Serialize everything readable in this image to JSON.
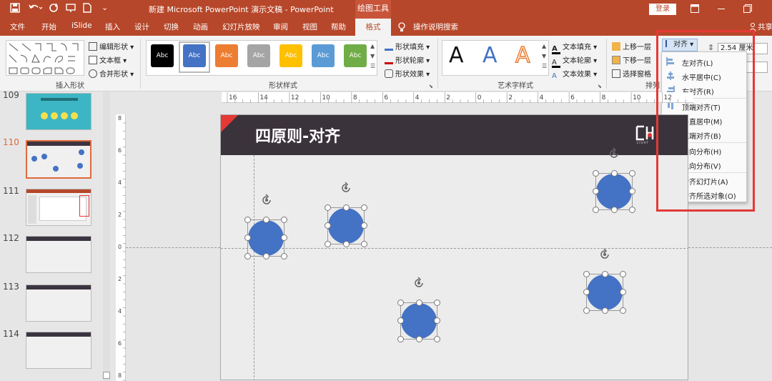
{
  "titlebar": {
    "title": "新建 Microsoft PowerPoint 演示文稿  -  PowerPoint",
    "context_tab": "绘图工具",
    "login": "登录"
  },
  "tabs": [
    "文件",
    "开始",
    "iSlide",
    "插入",
    "设计",
    "切换",
    "动画",
    "幻灯片放映",
    "审阅",
    "视图",
    "帮助",
    "格式"
  ],
  "tell_me": "操作说明搜索",
  "share": "共享",
  "ribbon": {
    "insert_shape": {
      "label": "插入形状",
      "edit_shape": "编辑形状",
      "text_box": "文本框",
      "merge_shapes": "合并形状"
    },
    "shape_styles": {
      "label": "形状样式",
      "swatch_text": "Abc",
      "fill": "形状填充",
      "outline": "形状轮廓",
      "effects": "形状效果",
      "swatch_colors": [
        "#000000",
        "#4472c4",
        "#ed7d31",
        "#a5a5a5",
        "#ffc000",
        "#5b9bd5",
        "#70ad47"
      ]
    },
    "wordart": {
      "label": "艺术字样式",
      "glyph": "A",
      "text_fill": "文本填充",
      "text_outline": "文本轮廓",
      "text_effects": "文本效果"
    },
    "arrange": {
      "label": "排列",
      "bring_forward": "上移一层",
      "send_backward": "下移一层",
      "selection_pane": "选择窗格",
      "align": "对齐"
    },
    "size": {
      "height": "2.54 厘米"
    }
  },
  "align_menu": {
    "items": [
      {
        "label": "左对齐(L)"
      },
      {
        "label": "水平居中(C)"
      },
      {
        "label": "右对齐(R)"
      },
      {
        "label": "顶端对齐(T)"
      },
      {
        "label": "垂直居中(M)"
      },
      {
        "label": "底端对齐(B)"
      },
      {
        "label": "横向分布(H)"
      },
      {
        "label": "纵向分布(V)"
      },
      {
        "label": "对齐幻灯片(A)"
      },
      {
        "label": "对齐所选对象(O)",
        "checked": true
      }
    ],
    "check": "✓"
  },
  "thumbnails": [
    {
      "num": "109"
    },
    {
      "num": "110",
      "selected": true
    },
    {
      "num": "111"
    },
    {
      "num": "112"
    },
    {
      "num": "113"
    },
    {
      "num": "114"
    }
  ],
  "slide": {
    "title": "四原则-对齐",
    "logo_text": "LIGHT"
  },
  "ruler": {
    "h_labels": [
      "16",
      "14",
      "12",
      "10",
      "8",
      "6",
      "4",
      "2",
      "0",
      "2",
      "4",
      "6",
      "8",
      "10",
      "12",
      "14"
    ],
    "v_labels": [
      "8",
      "6",
      "4",
      "2",
      "0",
      "2",
      "4",
      "6",
      "8"
    ]
  },
  "colors": {
    "brand": "#b7472a",
    "shape_fill": "#4472c4",
    "slide_header": "#3b333b",
    "highlight": "#e53935"
  }
}
